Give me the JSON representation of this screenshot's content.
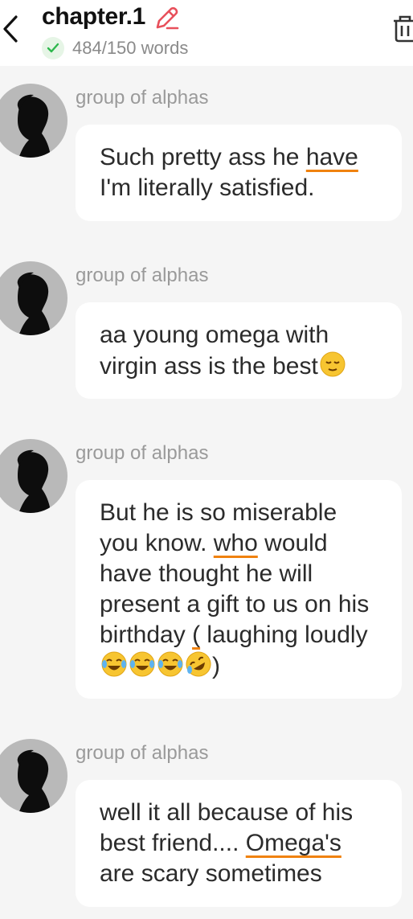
{
  "header": {
    "title": "chapter.1",
    "word_count": "484/150 words",
    "icons": {
      "back": "chevron-left-icon",
      "edit": "pencil-icon",
      "check": "check-circle-icon",
      "trash": "trash-icon"
    },
    "accent_color": "#e8505b",
    "check_color": "#2db84d"
  },
  "messages": [
    {
      "sender": "group of alphas",
      "segments": [
        "Such pretty ass he ",
        "have",
        " I'm literally satisfied."
      ]
    },
    {
      "sender": "group of alphas",
      "segments": [
        "aa young omega with virgin ass is the best"
      ],
      "emoji": [
        "relieved-face"
      ]
    },
    {
      "sender": "group of alphas",
      "segments": [
        "But he is so miserable you know. ",
        "who",
        " would have thought he will present a gift to us on his birthday ",
        "(",
        " laughing loudly "
      ],
      "emoji": [
        "tears-of-joy",
        "tears-of-joy",
        "tears-of-joy",
        "rolling-laughing"
      ],
      "closing": ")"
    },
    {
      "sender": "group of alphas",
      "segments": [
        "well it all because of his best friend.... ",
        "Omega's",
        " are scary sometimes"
      ]
    }
  ]
}
